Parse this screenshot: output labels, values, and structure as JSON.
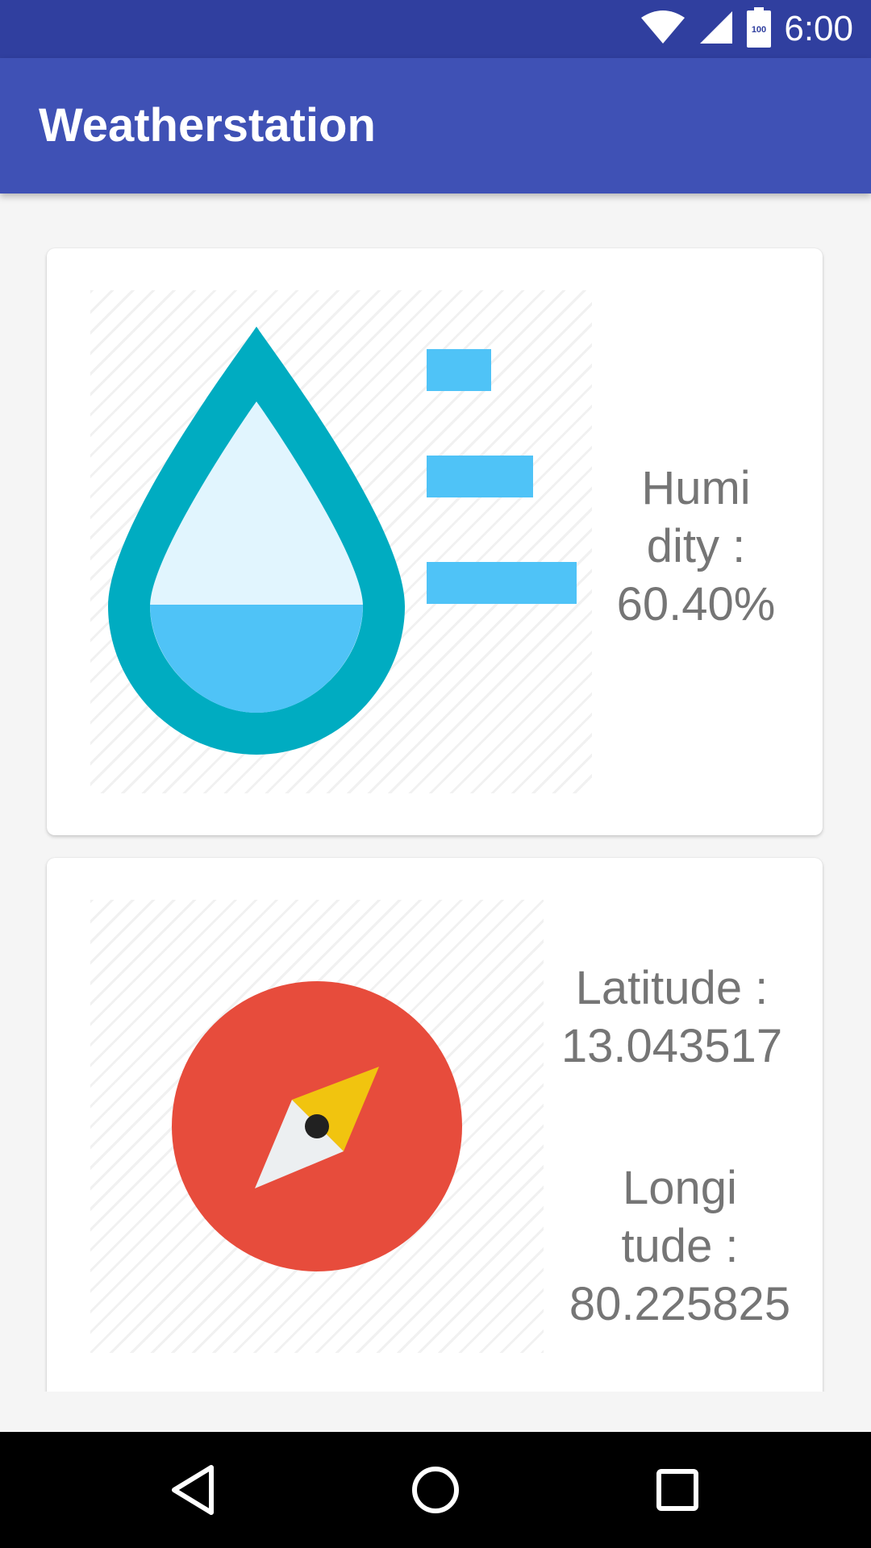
{
  "status_bar": {
    "time": "6:00",
    "battery_level": "100",
    "icons": [
      "wifi-icon",
      "signal-icon",
      "battery-icon"
    ]
  },
  "app_bar": {
    "title": "Weatherstation"
  },
  "humidity_card": {
    "label_line1": "Humi",
    "label_line2": "dity :",
    "value": "60.40%",
    "icon": "water-drop-humidity-icon"
  },
  "location_card": {
    "latitude_label": "Latitude :",
    "latitude_value": "13.043517",
    "longitude_label_line1": "Longi",
    "longitude_label_line2": "tude :",
    "longitude_value": "80.225825",
    "icon": "compass-icon"
  },
  "nav_bar": {
    "icons": [
      "back-icon",
      "home-icon",
      "recents-icon"
    ]
  },
  "colors": {
    "status_bar": "#303F9F",
    "app_bar": "#3F51B5",
    "drop_outline": "#00ACC1",
    "water_fill": "#4FC3F7",
    "compass_red": "#E74C3C",
    "compass_yellow": "#F1C40F"
  }
}
